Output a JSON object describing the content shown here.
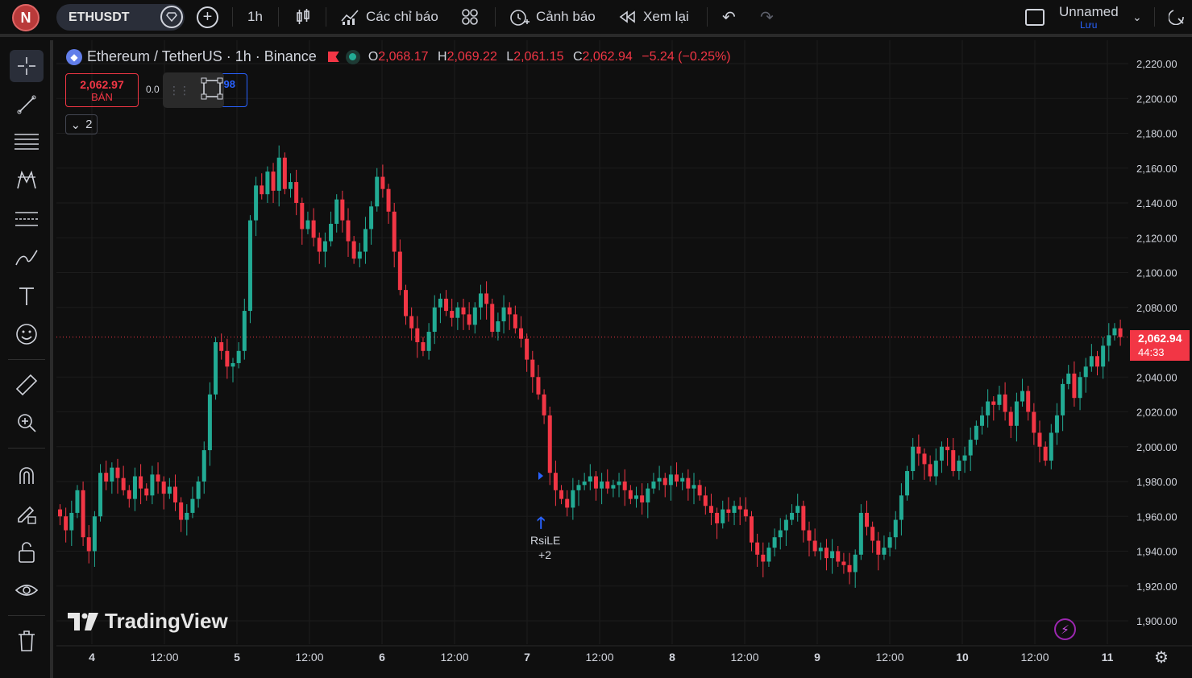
{
  "topbar": {
    "avatar_letter": "N",
    "symbol": "ETHUSDT",
    "interval": "1h",
    "indicators_label": "Các chỉ báo",
    "alerts_label": "Cảnh báo",
    "replay_label": "Xem lại",
    "layout_name": "Unnamed",
    "layout_save": "Lưu"
  },
  "legend": {
    "title": "Ethereum / TetherUS · 1h · Binance",
    "o_label": "O",
    "o_value": "2,068.17",
    "h_label": "H",
    "h_value": "2,069.22",
    "l_label": "L",
    "l_value": "2,061.15",
    "c_label": "C",
    "c_value": "2,062.94",
    "change": "−5.24 (−0.25%)"
  },
  "trade": {
    "sell_price": "2,062.97",
    "sell_label": "BÁN",
    "spread": "0.0",
    "buy_partial": "98",
    "collapse_count": "2"
  },
  "price_tag": {
    "price": "2,062.94",
    "countdown": "44:33"
  },
  "signal": {
    "name": "RsiLE",
    "extra": "+2"
  },
  "watermark": "TradingView",
  "colors": {
    "up": "#22ab94",
    "down": "#f23645",
    "accent": "#2962ff"
  },
  "chart_data": {
    "type": "candlestick",
    "symbol": "ETHUSDT",
    "interval": "1h",
    "y_ticks": [
      "2,220.00",
      "2,200.00",
      "2,180.00",
      "2,160.00",
      "2,140.00",
      "2,120.00",
      "2,100.00",
      "2,080.00",
      "2,040.00",
      "2,020.00",
      "2,000.00",
      "1,980.00",
      "1,960.00",
      "1,940.00",
      "1,920.00",
      "1,900.00"
    ],
    "x_ticks": [
      "4",
      "12:00",
      "5",
      "12:00",
      "6",
      "12:00",
      "7",
      "12:00",
      "8",
      "12:00",
      "9",
      "12:00",
      "10",
      "12:00",
      "11"
    ],
    "ylim": [
      1890,
      2225
    ],
    "last_price": 2062.94,
    "close": [
      1960,
      1952,
      1962,
      1975,
      1948,
      1940,
      1960,
      1985,
      1980,
      1988,
      1982,
      1975,
      1970,
      1983,
      1976,
      1972,
      1984,
      1980,
      1973,
      1977,
      1968,
      1958,
      1962,
      1970,
      1980,
      1998,
      2030,
      2060,
      2055,
      2046,
      2048,
      2055,
      2078,
      2130,
      2150,
      2145,
      2158,
      2147,
      2166,
      2148,
      2152,
      2140,
      2125,
      2130,
      2120,
      2112,
      2118,
      2128,
      2142,
      2130,
      2118,
      2108,
      2112,
      2125,
      2138,
      2155,
      2148,
      2135,
      2112,
      2090,
      2075,
      2068,
      2060,
      2055,
      2066,
      2080,
      2085,
      2078,
      2074,
      2080,
      2076,
      2070,
      2080,
      2088,
      2082,
      2066,
      2072,
      2080,
      2076,
      2068,
      2062,
      2050,
      2040,
      2030,
      2018,
      1985,
      1975,
      1970,
      1965,
      1975,
      1978,
      1980,
      1983,
      1976,
      1980,
      1976,
      1978,
      1980,
      1975,
      1970,
      1972,
      1968,
      1976,
      1980,
      1982,
      1978,
      1984,
      1980,
      1982,
      1976,
      1978,
      1972,
      1966,
      1962,
      1956,
      1964,
      1962,
      1966,
      1964,
      1960,
      1945,
      1938,
      1934,
      1942,
      1948,
      1952,
      1958,
      1962,
      1966,
      1952,
      1946,
      1940,
      1942,
      1936,
      1940,
      1934,
      1932,
      1928,
      1938,
      1962,
      1954,
      1946,
      1938,
      1942,
      1948,
      1958,
      1972,
      1986,
      2000,
      1996,
      1990,
      1983,
      1992,
      2000,
      1998,
      1986,
      1992,
      1995,
      2004,
      2012,
      2018,
      2026,
      2024,
      2030,
      2020,
      2012,
      2026,
      2032,
      2020,
      2008,
      2000,
      1992,
      2008,
      2018,
      2036,
      2042,
      2028,
      2040,
      2046,
      2052,
      2046,
      2058,
      2064,
      2068,
      2062.94
    ]
  }
}
